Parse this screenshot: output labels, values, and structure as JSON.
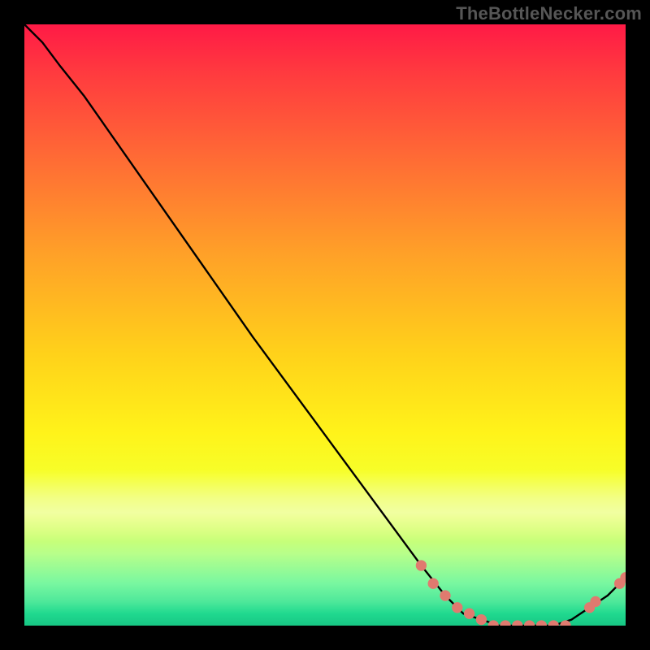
{
  "attribution": "TheBottleNecker.com",
  "chart_data": {
    "type": "line",
    "title": "",
    "xlabel": "",
    "ylabel": "",
    "xlim": [
      0,
      100
    ],
    "ylim": [
      0,
      100
    ],
    "x": [
      0,
      3,
      6,
      10,
      24,
      38,
      52,
      66,
      70,
      73,
      76,
      79,
      82,
      85,
      88,
      91,
      94,
      97,
      100
    ],
    "y": [
      100,
      97,
      93,
      88,
      68,
      48,
      29,
      10,
      5,
      2,
      1,
      0,
      0,
      0,
      0,
      1,
      3,
      5,
      8
    ],
    "markers": {
      "x": [
        66,
        68,
        70,
        72,
        74,
        76,
        78,
        80,
        82,
        84,
        86,
        88,
        90,
        94,
        95,
        99,
        100
      ],
      "y": [
        10,
        7,
        5,
        3,
        2,
        1,
        0,
        0,
        0,
        0,
        0,
        0,
        0,
        3,
        4,
        7,
        8
      ]
    },
    "curve_color": "#000000",
    "marker_color": "#e07a6f"
  }
}
